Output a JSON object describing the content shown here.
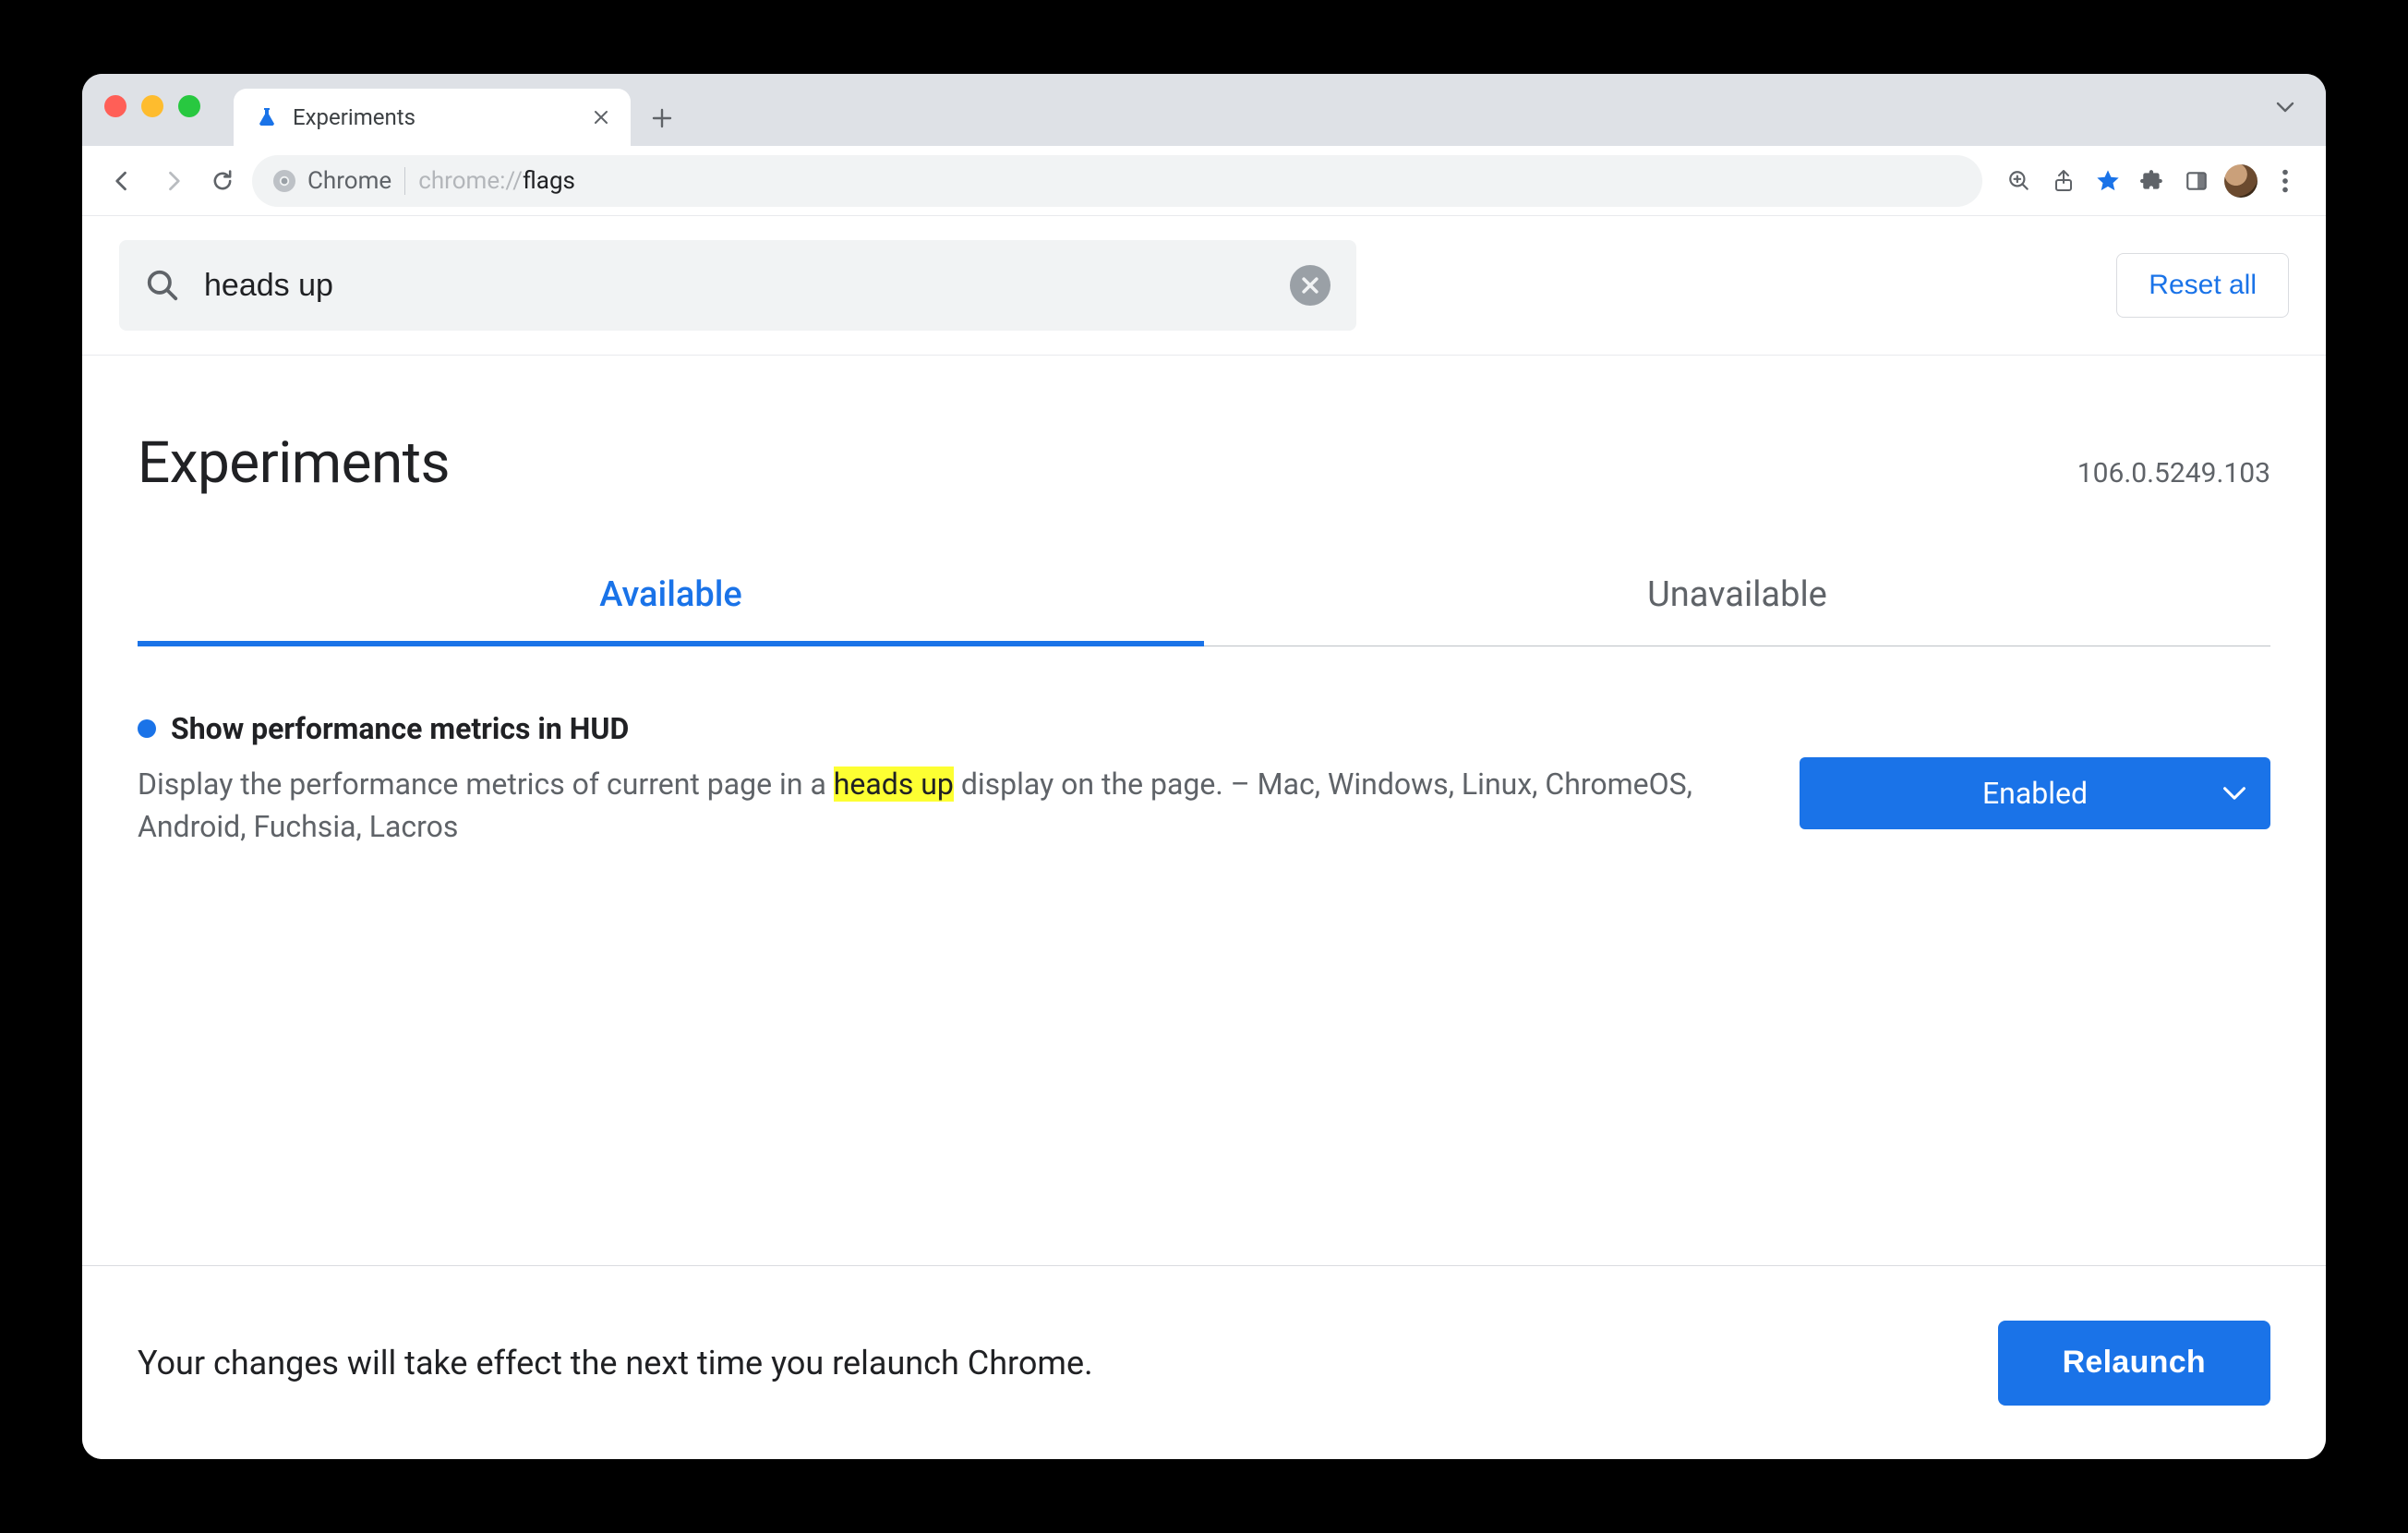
{
  "tab": {
    "title": "Experiments"
  },
  "omnibox": {
    "scheme_label": "Chrome",
    "url_prefix": "chrome://",
    "url_path": "flags"
  },
  "search": {
    "value": "heads up"
  },
  "reset_all_label": "Reset all",
  "page_title": "Experiments",
  "version": "106.0.5249.103",
  "tabs": {
    "available": "Available",
    "unavailable": "Unavailable"
  },
  "flag": {
    "title": "Show performance metrics in HUD",
    "desc_before": "Display the performance metrics of current page in a ",
    "desc_highlight": "heads up",
    "desc_after": " display on the page. – Mac, Windows, Linux, ChromeOS, Android, Fuchsia, Lacros",
    "selected": "Enabled"
  },
  "relaunch": {
    "message": "Your changes will take effect the next time you relaunch Chrome.",
    "button": "Relaunch"
  }
}
